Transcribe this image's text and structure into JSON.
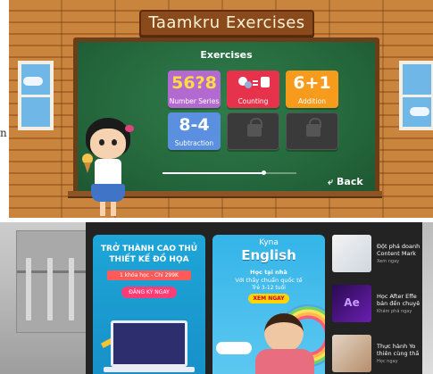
{
  "game": {
    "title": "Taamkru Exercises",
    "board_heading": "Exercises",
    "tiles": [
      {
        "glyph": "56?8",
        "label": "Number Series",
        "color": "#b36ad0",
        "glyph_color": "#ffdb43"
      },
      {
        "glyph": "",
        "label": "Counting",
        "color": "#e6324b",
        "glyph_color": "#ffffff"
      },
      {
        "glyph": "6+1",
        "label": "Addition",
        "color": "#f79b1c",
        "glyph_color": "#ffffff"
      },
      {
        "glyph": "8-4",
        "label": "Subtraction",
        "color": "#5b8fe0",
        "glyph_color": "#ffffff"
      },
      {
        "glyph": "",
        "label": "",
        "color": "#3a3a3a",
        "glyph_color": ""
      },
      {
        "glyph": "",
        "label": "",
        "color": "#3a3a3a",
        "glyph_color": ""
      }
    ],
    "progress": 0.75,
    "back_label": "Back"
  },
  "stray_text": "n",
  "ads": {
    "ad1": {
      "heading": "TRỞ THÀNH CAO THỦ THIẾT KẾ ĐỒ HỌA",
      "price": "1 khóa học - Chỉ 299K",
      "cta": "ĐĂNG KÝ NGAY"
    },
    "ad2": {
      "brand_top": "Kyna",
      "brand": "English",
      "line1": "Học tại nhà",
      "line2": "Với thầy chuẩn quốc tế",
      "line3": "Trẻ 3-12 tuổi",
      "cta": "XEM NGAY"
    },
    "list": [
      {
        "title": "Đột phá doanh Content Mark",
        "meta": "Xem ngay"
      },
      {
        "title": "Học After Effe bản đến chuyê",
        "meta": "Khám phá ngay",
        "thumb_text": "Ae"
      },
      {
        "title": "Thực hành Yo thiên cùng thầ",
        "meta": "Học ngay"
      }
    ]
  },
  "colors": {
    "wood": "#c9843e",
    "chalkboard": "#23643a",
    "ad_bg": "#232323"
  }
}
